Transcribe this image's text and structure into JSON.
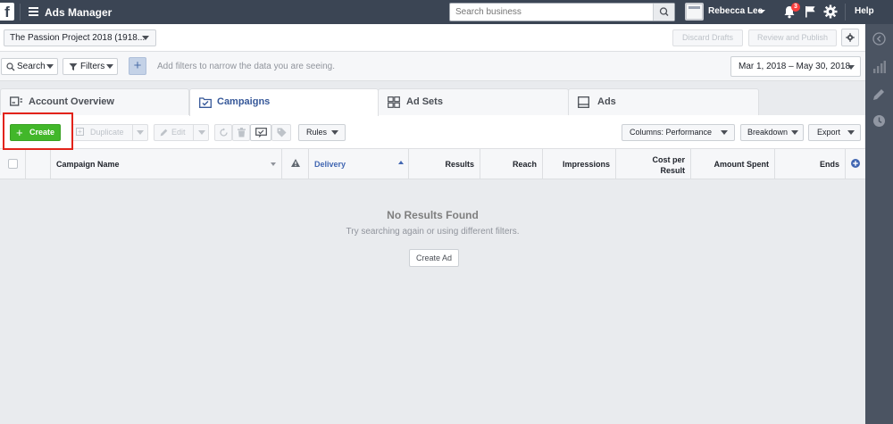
{
  "topbar": {
    "logo": "f",
    "app_title": "Ads Manager",
    "search_placeholder": "Search business",
    "user_name": "Rebecca Lee",
    "notification_count": "3",
    "help_label": "Help"
  },
  "account_bar": {
    "account_name": "The Passion Project 2018 (1918...",
    "discard_label": "Discard Drafts",
    "review_label": "Review and Publish"
  },
  "filter_bar": {
    "search_label": "Search",
    "filters_label": "Filters",
    "add_label": "+",
    "hint": "Add filters to narrow the data you are seeing.",
    "date_range": "Mar 1, 2018 – May 30, 2018"
  },
  "tabs": [
    {
      "label": "Account Overview",
      "icon": "account-overview-icon"
    },
    {
      "label": "Campaigns",
      "icon": "campaigns-icon",
      "active": true
    },
    {
      "label": "Ad Sets",
      "icon": "ad-sets-icon"
    },
    {
      "label": "Ads",
      "icon": "ads-icon"
    }
  ],
  "toolbar": {
    "create_label": "Create",
    "duplicate_label": "Duplicate",
    "edit_label": "Edit",
    "rules_label": "Rules",
    "columns_label": "Columns: Performance",
    "breakdown_label": "Breakdown",
    "export_label": "Export"
  },
  "table": {
    "columns": [
      "Campaign Name",
      "Delivery",
      "Results",
      "Reach",
      "Impressions",
      "Cost per Result",
      "Amount Spent",
      "Ends"
    ]
  },
  "empty_state": {
    "title": "No Results Found",
    "subtitle": "Try searching again or using different filters.",
    "button_label": "Create Ad"
  },
  "colors": {
    "topbar": "#3b4554",
    "create_green": "#42b72a",
    "link_blue": "#365899",
    "highlight_red": "#e2231a"
  }
}
